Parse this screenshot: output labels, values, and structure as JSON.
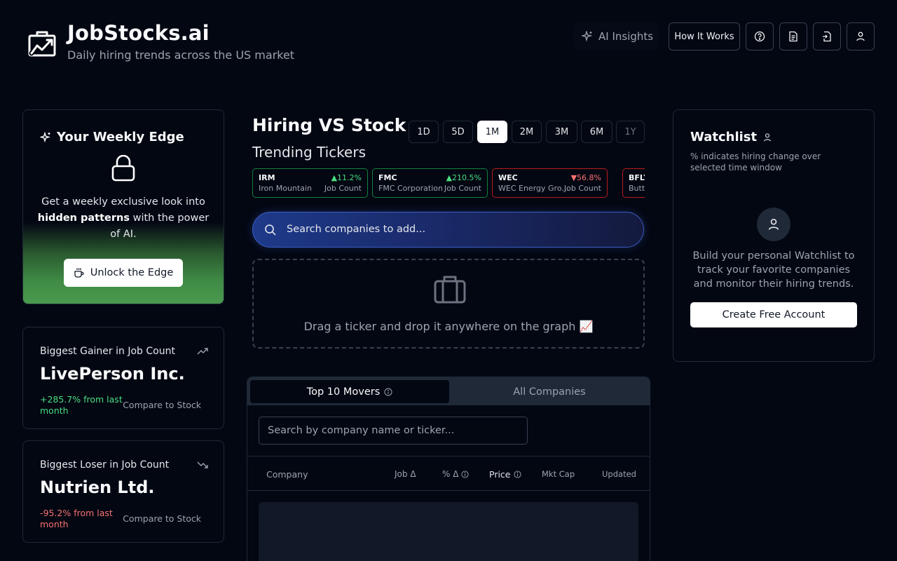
{
  "header": {
    "title": "JobStocks.ai",
    "subtitle": "Daily hiring trends across the US market",
    "ai_insights": "AI Insights",
    "how_it_works": "How It Works"
  },
  "edge": {
    "title": "Your Weekly Edge",
    "text_before": "Get a weekly exclusive look into ",
    "text_bold": "hidden patterns",
    "text_after": " with the power of AI.",
    "button": "Unlock the Edge"
  },
  "gainer": {
    "label": "Biggest Gainer in Job Count",
    "company": "LivePerson Inc.",
    "change": "+285.7% from last month",
    "compare": "Compare to Stock"
  },
  "loser": {
    "label": "Biggest Loser in Job Count",
    "company": "Nutrien Ltd.",
    "change": "-95.2% from last month",
    "compare": "Compare to Stock"
  },
  "main": {
    "title": "Hiring VS Stock",
    "timeframes": [
      "1D",
      "5D",
      "1M",
      "2M",
      "3M",
      "6M",
      "1Y"
    ],
    "active_timeframe": "1M",
    "trending_title": "Trending Tickers",
    "tickers": [
      {
        "symbol": "IRM",
        "change": "▲11.2%",
        "name": "Iron Mountain",
        "metric": "Job Count",
        "direction": "up"
      },
      {
        "symbol": "FMC",
        "change": "▲210.5%",
        "name": "FMC Corporation",
        "metric": "Job Count",
        "direction": "up"
      },
      {
        "symbol": "WEC",
        "change": "▼56.8%",
        "name": "WEC Energy Grou...",
        "metric": "Job Count",
        "direction": "down"
      },
      {
        "symbol": "BFLY",
        "change": "",
        "name": "Butte",
        "metric": "",
        "direction": "down"
      }
    ],
    "search_placeholder": "Search companies to add...",
    "drop_text": "Drag a ticker and drop it anywhere on the graph 📈"
  },
  "table": {
    "tabs": [
      "Top 10 Movers",
      "All Companies"
    ],
    "filter_placeholder": "Search by company name or ticker...",
    "columns": [
      "Company",
      "Job Δ",
      "% Δ",
      "Price",
      "Mkt Cap",
      "Updated"
    ]
  },
  "watchlist": {
    "title": "Watchlist",
    "note": "% indicates hiring change over selected time window",
    "text": "Build your personal Watchlist to track your favorite companies and monitor their hiring trends.",
    "button": "Create Free Account"
  },
  "colors": {
    "background": "#030712",
    "positive": "#4ade80",
    "negative": "#f87171",
    "border": "#1f2937",
    "accent_search": "#1e3a8a"
  },
  "icons": [
    "chart-briefcase-logo-icon",
    "sparkles-icon",
    "help-circle-icon",
    "document-icon",
    "file-export-icon",
    "user-icon",
    "lock-icon",
    "coffee-cup-icon",
    "trending-up-icon",
    "trending-down-icon",
    "search-icon",
    "briefcase-icon",
    "info-icon"
  ]
}
